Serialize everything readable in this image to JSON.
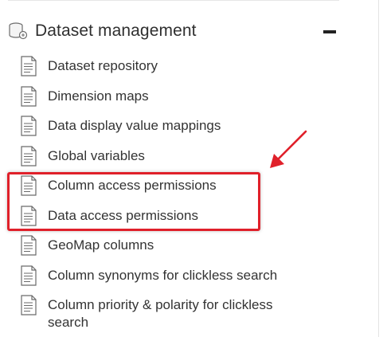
{
  "section": {
    "title": "Dataset management",
    "icon": "database-stack-icon",
    "collapse_icon": "minus-icon"
  },
  "items": [
    {
      "label": "Dataset repository",
      "icon": "document-icon"
    },
    {
      "label": "Dimension maps",
      "icon": "document-icon"
    },
    {
      "label": "Data display value mappings",
      "icon": "document-icon"
    },
    {
      "label": "Global variables",
      "icon": "document-icon"
    },
    {
      "label": "Column access permissions",
      "icon": "document-icon",
      "highlighted": true
    },
    {
      "label": "Data access permissions",
      "icon": "document-icon",
      "highlighted": true
    },
    {
      "label": "GeoMap columns",
      "icon": "document-icon"
    },
    {
      "label": "Column synonyms for clickless search",
      "icon": "document-icon"
    },
    {
      "label": "Column priority & polarity for clickless search",
      "icon": "document-icon"
    }
  ],
  "annotation": {
    "highlight_color": "#e0202a",
    "arrow_color": "#e0202a"
  }
}
